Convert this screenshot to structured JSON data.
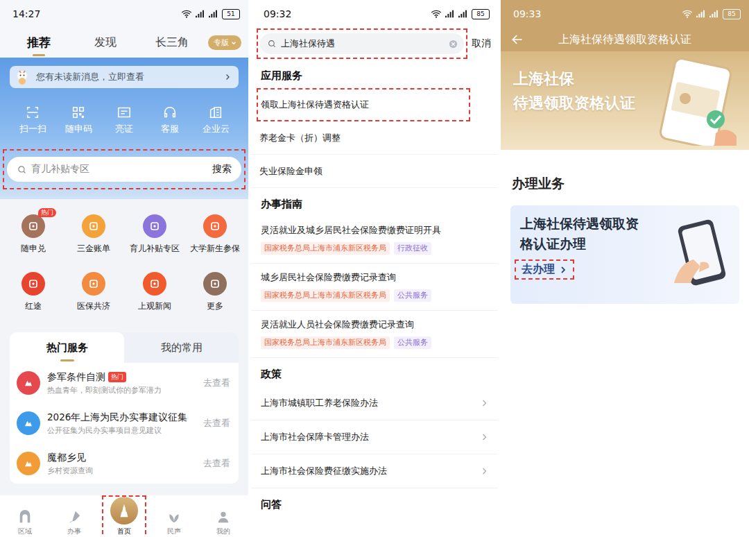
{
  "home": {
    "status": {
      "time": "14:27",
      "battery": "51"
    },
    "tabs": [
      {
        "label": "推荐",
        "selected": true
      },
      {
        "label": "发现",
        "selected": false
      },
      {
        "label": "长三角",
        "selected": false
      }
    ],
    "edition": "专版",
    "notice": "您有未读新消息，立即查看",
    "quick_actions": [
      "扫一扫",
      "随申码",
      "亮证",
      "客服",
      "企业云"
    ],
    "search": {
      "placeholder": "育儿补贴专区",
      "button": "搜索",
      "highlighted": true
    },
    "grid": [
      {
        "label": "随申兑",
        "badge": "热门",
        "color": "#a5735c"
      },
      {
        "label": "三金账单",
        "color": "#f4a23a"
      },
      {
        "label": "育儿补贴专区",
        "color": "#8b74dc"
      },
      {
        "label": "大学新生参保",
        "color": "#f26a3d"
      },
      {
        "label": "红途",
        "color": "#e8432e"
      },
      {
        "label": "医保共济",
        "color": "#f28b3f"
      },
      {
        "label": "上观新闻",
        "color": "#f05a2c"
      },
      {
        "label": "更多",
        "color": "#8f705f"
      }
    ],
    "card_tabs": [
      {
        "label": "热门服务",
        "selected": true
      },
      {
        "label": "我的常用",
        "selected": false
      }
    ],
    "services": [
      {
        "title": "参军条件自测",
        "badge": "热门",
        "subtitle": "热血青年，即刻测试你的参军潜力",
        "action": "去查看",
        "color": "#e5484d"
      },
      {
        "title": "2026年上海为民办实事建议征集",
        "subtitle": "公开征集为民办实事项目意见建议",
        "action": "去查看",
        "color": "#3d9be9"
      },
      {
        "title": "魔都乡见",
        "subtitle": "乡村资源查询",
        "action": "去查看",
        "color": "#f29c38"
      }
    ],
    "nav": [
      {
        "label": "区域",
        "selected": false,
        "highlighted": false
      },
      {
        "label": "办事",
        "selected": false,
        "highlighted": false
      },
      {
        "label": "首页",
        "selected": true,
        "highlighted": true
      },
      {
        "label": "民声",
        "selected": false,
        "highlighted": false
      },
      {
        "label": "我的",
        "selected": false,
        "highlighted": false
      }
    ]
  },
  "search": {
    "status": {
      "time": "09:32",
      "battery": "85"
    },
    "query": "上海社保待遇",
    "highlighted": true,
    "cancel": "取消",
    "apps": {
      "title": "应用服务",
      "items": [
        {
          "label": "领取上海社保待遇资格认证",
          "highlighted": true
        },
        {
          "label": "养老金卡（折）调整",
          "highlighted": false
        },
        {
          "label": "失业保险金申领",
          "highlighted": false
        }
      ]
    },
    "guides": {
      "title": "办事指南",
      "items": [
        {
          "title": "灵活就业及城乡居民社会保险费缴费证明开具",
          "tags": [
            {
              "label": "国家税务总局上海市浦东新区税务局",
              "color": "#e8663d"
            },
            {
              "label": "行政征收",
              "color": "#8b6fd6"
            }
          ]
        },
        {
          "title": "城乡居民社会保险费缴费记录查询",
          "tags": [
            {
              "label": "国家税务总局上海市浦东新区税务局",
              "color": "#e8663d"
            },
            {
              "label": "公共服务",
              "color": "#8b6fd6"
            }
          ]
        },
        {
          "title": "灵活就业人员社会保险费缴费记录查询",
          "tags": [
            {
              "label": "国家税务总局上海市浦东新区税务局",
              "color": "#e8663d"
            },
            {
              "label": "公共服务",
              "color": "#8b6fd6"
            }
          ]
        }
      ]
    },
    "policies": {
      "title": "政策",
      "items": [
        "上海市城镇职工养老保险办法",
        "上海市社会保障卡管理办法",
        "上海市社会保险费征缴实施办法"
      ]
    },
    "qa": {
      "title": "问答"
    }
  },
  "detail": {
    "status": {
      "time": "09:33",
      "battery": "85"
    },
    "title": "上海社保待遇领取资格认证",
    "banner": [
      "上海社保",
      "待遇领取资格认证"
    ],
    "section": "办理业务",
    "card": {
      "title": "上海社保待遇领取资格认证办理",
      "action": "去办理",
      "highlighted": true
    }
  }
}
